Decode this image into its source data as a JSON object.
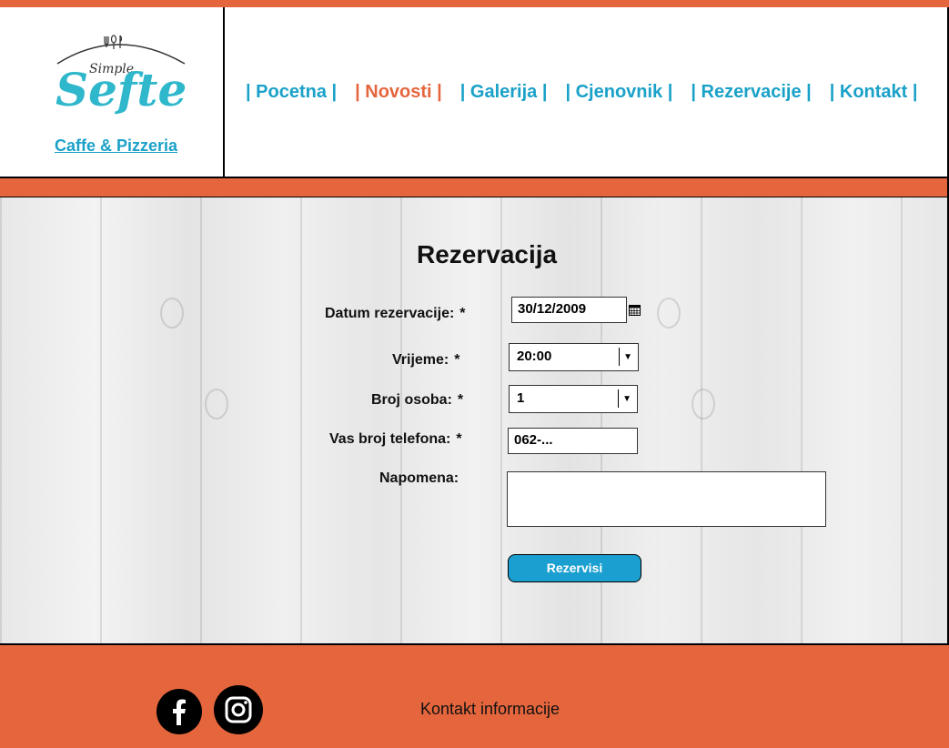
{
  "logo": {
    "script_small": "Simple",
    "script_large": "Sefte",
    "subtitle": "Caffe & Pizzeria"
  },
  "nav": {
    "items": [
      {
        "label": "| Pocetna |",
        "active": false
      },
      {
        "label": "| Novosti |",
        "active": true
      },
      {
        "label": "| Galerija |",
        "active": false
      },
      {
        "label": "| Cjenovnik |",
        "active": false
      },
      {
        "label": "| Rezervacije |",
        "active": false
      },
      {
        "label": "| Kontakt |",
        "active": false
      }
    ]
  },
  "form": {
    "title": "Rezervacija",
    "date_label": "Datum rezervacije:",
    "date_value": "30/12/2009",
    "time_label": "Vrijeme:",
    "time_value": "20:00",
    "persons_label": "Broj osoba:",
    "persons_value": "1",
    "phone_label": "Vas broj telefona:",
    "phone_value": "062-...",
    "note_label": "Napomena:",
    "required_mark": "*",
    "submit_label": "Rezervisi"
  },
  "footer": {
    "contact_label": "Kontakt informacije"
  },
  "colors": {
    "accent_orange": "#e5663d",
    "brand_blue": "#1aa1c8",
    "button_blue": "#1a9fd0"
  },
  "icons": [
    "calendar-icon",
    "chevron-down-icon",
    "facebook-icon",
    "instagram-icon"
  ]
}
